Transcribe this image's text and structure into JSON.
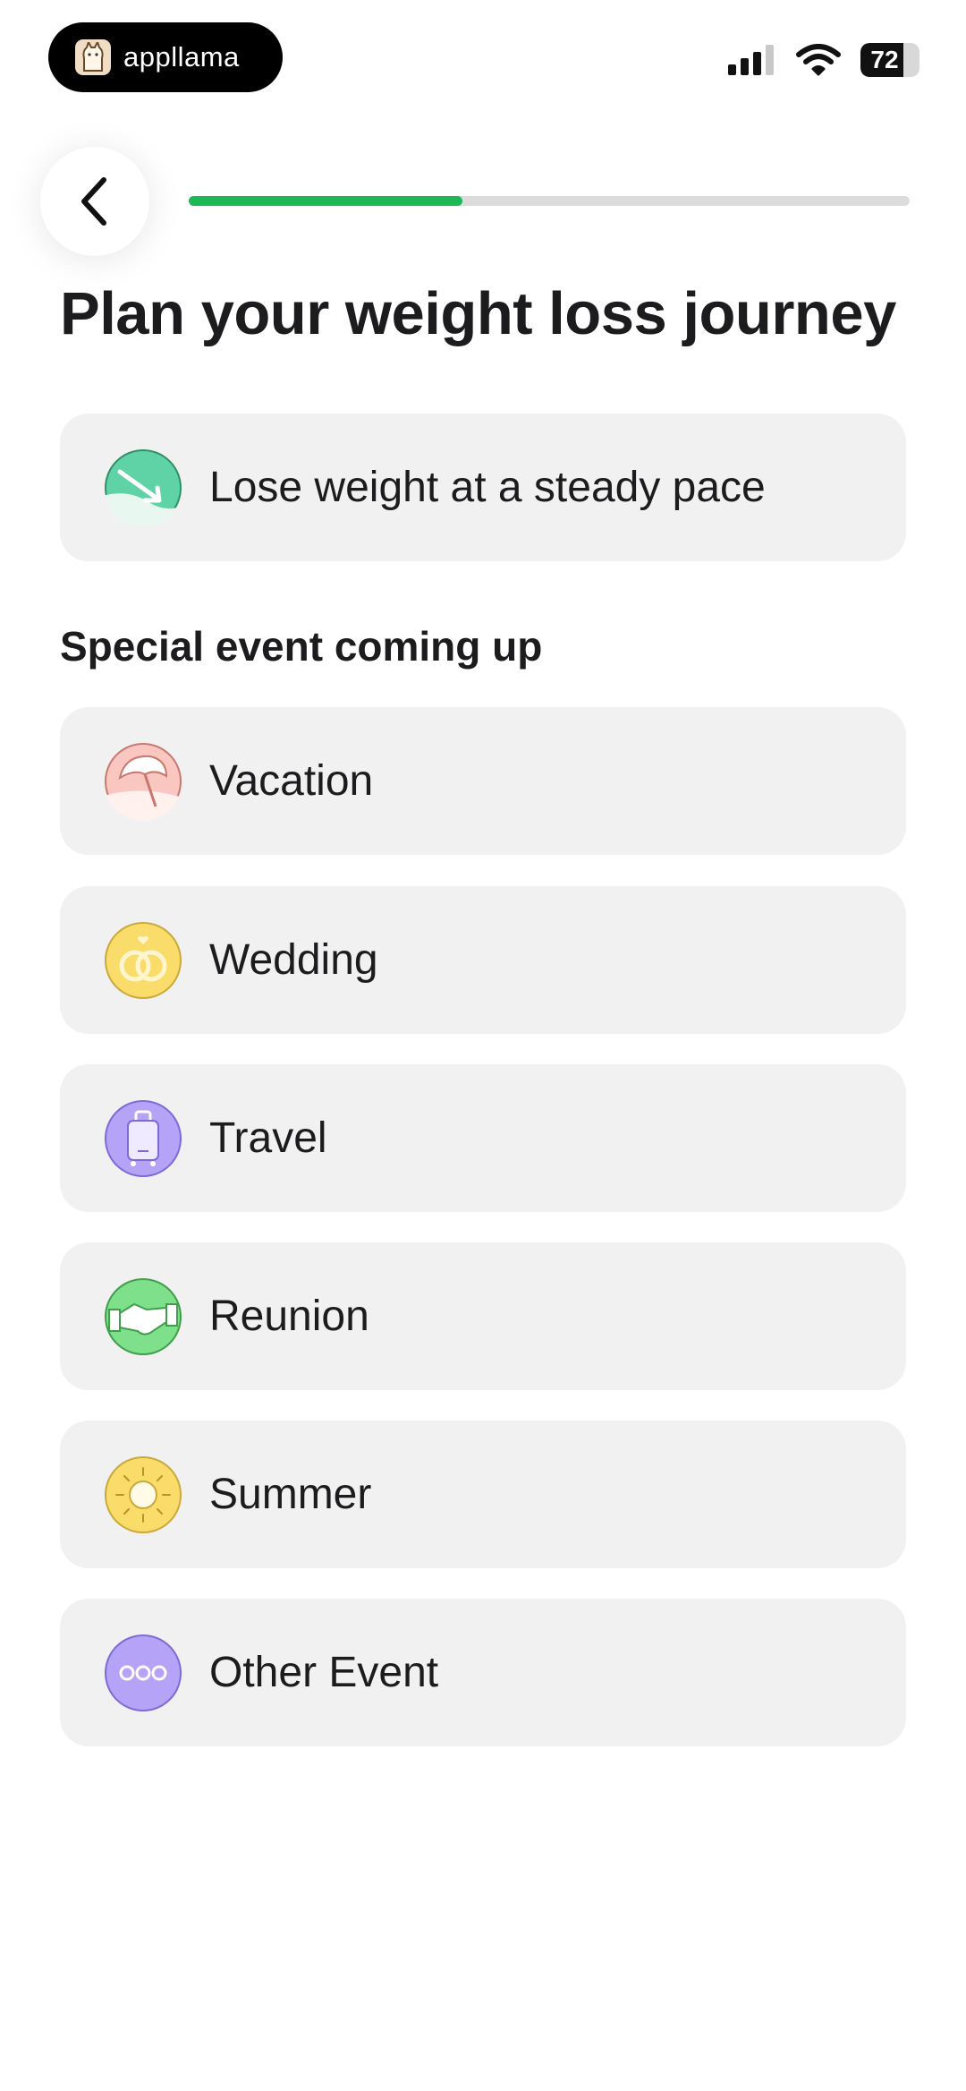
{
  "status_bar": {
    "app_name": "appllama",
    "battery": "72",
    "battery_level": 0.72
  },
  "progress": {
    "value": 0.38
  },
  "title": "Plan your weight loss journey",
  "primary_option": {
    "label": "Lose weight at a steady pace",
    "icon": "trend-down-icon"
  },
  "section_title": "Special event coming up",
  "events": [
    {
      "label": "Vacation",
      "icon": "umbrella-icon"
    },
    {
      "label": "Wedding",
      "icon": "rings-icon"
    },
    {
      "label": "Travel",
      "icon": "suitcase-icon"
    },
    {
      "label": "Reunion",
      "icon": "handshake-icon"
    },
    {
      "label": "Summer",
      "icon": "sun-icon"
    },
    {
      "label": "Other Event",
      "icon": "more-icon"
    }
  ],
  "colors": {
    "progress": "#1db954",
    "card": "#f1f1f1"
  }
}
